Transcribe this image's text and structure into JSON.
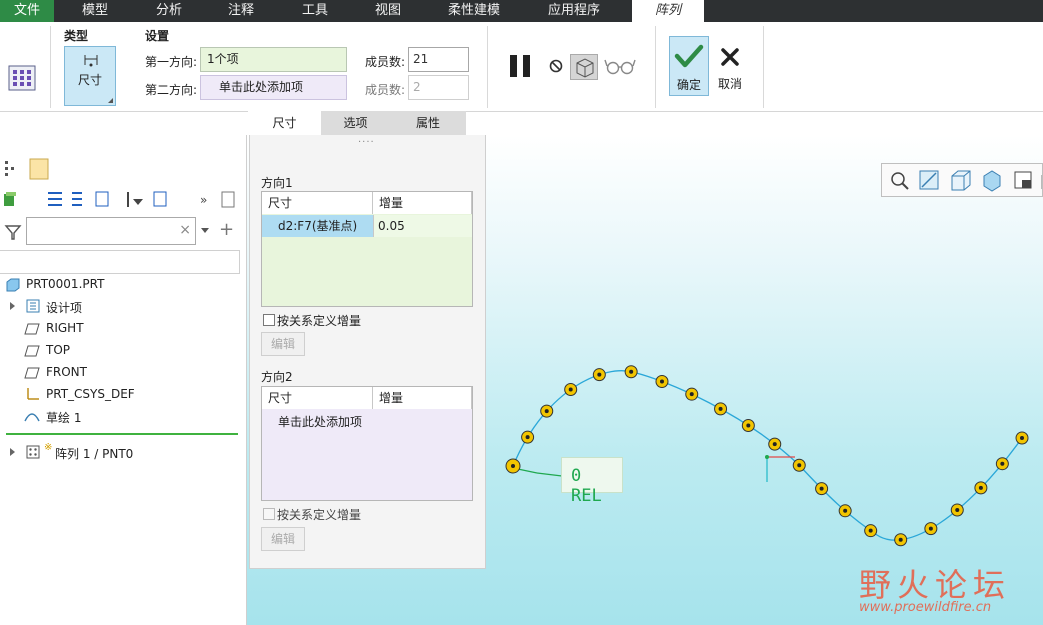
{
  "menu": {
    "file": "文件",
    "tabs": [
      "模型",
      "分析",
      "注释",
      "工具",
      "视图",
      "柔性建模",
      "应用程序"
    ],
    "active": "阵列"
  },
  "ribbon": {
    "type_group": "类型",
    "type_button": "尺寸",
    "settings_group": "设置",
    "dir1_label": "第一方向:",
    "dir1_value": "1个项",
    "dir2_label": "第二方向:",
    "dir2_value": "单击此处添加项",
    "members_label": "成员数:",
    "members1": "21",
    "members2": "2",
    "ok": "确定",
    "cancel": "取消"
  },
  "subtabs": [
    "尺寸",
    "选项",
    "属性"
  ],
  "dashboard": {
    "dir1_title": "方向1",
    "dir2_title": "方向2",
    "col_dim": "尺寸",
    "col_inc": "增量",
    "row_dim": "d2:F7(基准点)",
    "row_inc": "0.05",
    "add_item": "单击此处添加项",
    "relation_cb": "按关系定义增量",
    "edit_btn": "编辑"
  },
  "tree": {
    "root": "PRT0001.PRT",
    "items": [
      "设计项",
      "RIGHT",
      "TOP",
      "FRONT",
      "PRT_CSYS_DEF",
      "草绘 1"
    ],
    "pattern": "阵列 1 / PNT0"
  },
  "annotation": {
    "label": "0 REL"
  },
  "watermark": {
    "title": "野火论坛",
    "url": "www.proewildfire.cn"
  },
  "colors": {
    "accent_green": "#2e8b46",
    "curve": "#2aa7d8",
    "point_fill": "#f2c500"
  }
}
